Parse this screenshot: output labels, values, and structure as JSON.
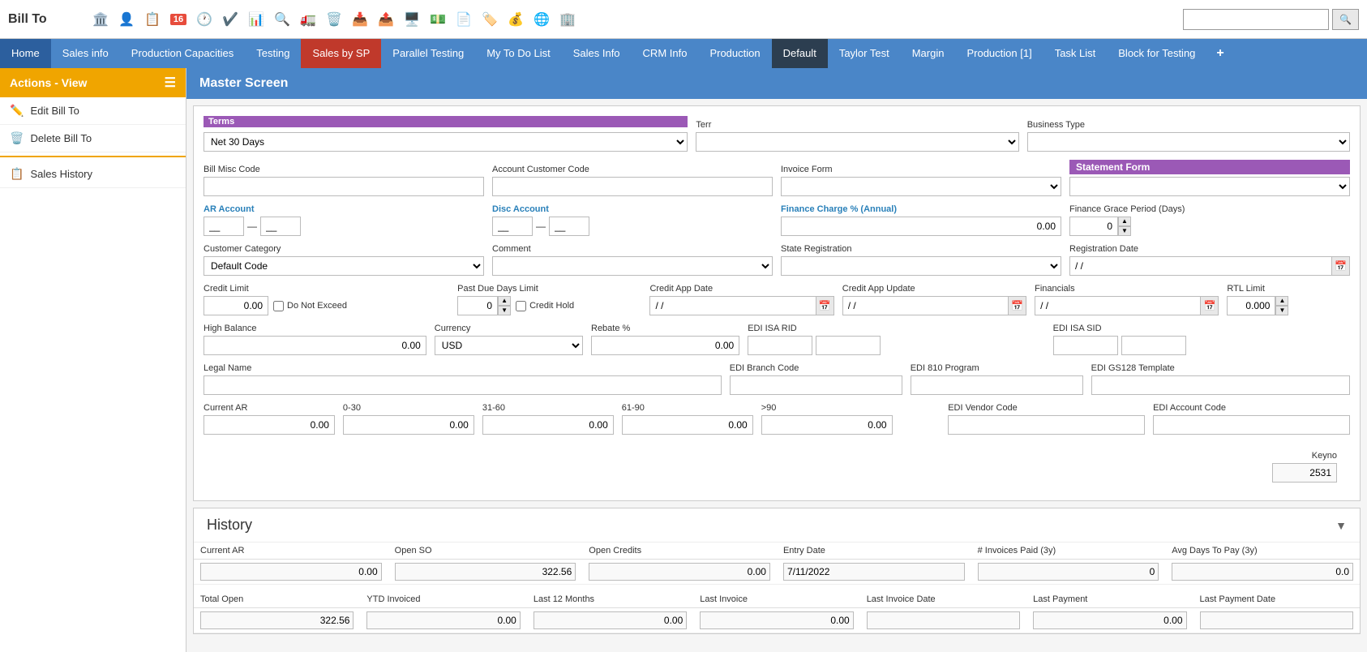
{
  "topbar": {
    "title": "Bill To",
    "search_placeholder": ""
  },
  "nav_tabs": [
    {
      "id": "home",
      "label": "Home",
      "class": "home"
    },
    {
      "id": "sales-info",
      "label": "Sales info"
    },
    {
      "id": "production-capacities",
      "label": "Production Capacities"
    },
    {
      "id": "testing",
      "label": "Testing"
    },
    {
      "id": "sales-by-sp",
      "label": "Sales by SP",
      "class": "active"
    },
    {
      "id": "parallel-testing",
      "label": "Parallel Testing"
    },
    {
      "id": "my-to-do-list",
      "label": "My To Do List"
    },
    {
      "id": "sales-info-2",
      "label": "Sales Info"
    },
    {
      "id": "crm-info",
      "label": "CRM Info"
    },
    {
      "id": "production",
      "label": "Production"
    },
    {
      "id": "default",
      "label": "Default"
    },
    {
      "id": "taylor-test",
      "label": "Taylor Test"
    },
    {
      "id": "margin",
      "label": "Margin"
    },
    {
      "id": "production-1",
      "label": "Production [1]"
    },
    {
      "id": "task-list",
      "label": "Task List"
    },
    {
      "id": "block-for-testing",
      "label": "Block for Testing"
    }
  ],
  "sidebar": {
    "header": "Actions - View",
    "items": [
      {
        "id": "edit-bill-to",
        "icon": "✏️",
        "label": "Edit Bill To"
      },
      {
        "id": "delete-bill-to",
        "icon": "🗑️",
        "label": "Delete Bill To"
      },
      {
        "id": "sales-history",
        "icon": "📋",
        "label": "Sales History"
      }
    ]
  },
  "content": {
    "header": "Master Screen",
    "terms_label": "Terms",
    "terms_value": "Net 30 Days",
    "terr_label": "Terr",
    "business_type_label": "Business Type",
    "bill_misc_code_label": "Bill Misc Code",
    "account_customer_code_label": "Account Customer Code",
    "invoice_form_label": "Invoice Form",
    "statement_form_label": "Statement Form",
    "ar_account_label": "AR Account",
    "disc_account_label": "Disc Account",
    "finance_charge_label": "Finance Charge % (Annual)",
    "finance_grace_label": "Finance Grace Period (Days)",
    "finance_grace_value": "0",
    "finance_charge_value": "0.00",
    "customer_category_label": "Customer Category",
    "customer_category_value": "Default Code",
    "comment_label": "Comment",
    "state_registration_label": "State Registration",
    "registration_date_label": "Registration Date",
    "registration_date_value": "/ /",
    "credit_limit_label": "Credit Limit",
    "credit_limit_value": "0.00",
    "do_not_exceed_label": "Do Not Exceed",
    "past_due_days_label": "Past Due Days Limit",
    "past_due_days_value": "0",
    "credit_hold_label": "Credit Hold",
    "credit_app_date_label": "Credit App Date",
    "credit_app_date_value": "/ /",
    "credit_app_update_label": "Credit App Update",
    "credit_app_update_value": "/ /",
    "financials_label": "Financials",
    "financials_value": "/ /",
    "rtl_limit_label": "RTL Limit",
    "rtl_limit_value": "0.000",
    "high_balance_label": "High Balance",
    "high_balance_value": "0.00",
    "currency_label": "Currency",
    "currency_value": "USD",
    "rebate_label": "Rebate %",
    "rebate_value": "0.00",
    "edi_isa_rid_label": "EDI ISA RID",
    "edi_isa_sid_label": "EDI ISA SID",
    "legal_name_label": "Legal Name",
    "edi_branch_code_label": "EDI Branch Code",
    "edi_810_program_label": "EDI 810 Program",
    "edi_gs128_label": "EDI GS128 Template",
    "current_ar_label": "Current AR",
    "ar_0_30_label": "0-30",
    "ar_31_60_label": "31-60",
    "ar_61_90_label": "61-90",
    "ar_90_plus_label": ">90",
    "edi_vendor_code_label": "EDI Vendor Code",
    "edi_account_code_label": "EDI Account Code",
    "current_ar_value": "0.00",
    "ar_0_30_value": "0.00",
    "ar_31_60_value": "0.00",
    "ar_61_90_value": "0.00",
    "ar_90_plus_value": "0.00",
    "keyno_label": "Keyno",
    "keyno_value": "2531"
  },
  "history": {
    "title": "History",
    "current_ar_label": "Current AR",
    "current_ar_value": "0.00",
    "open_so_label": "Open SO",
    "open_so_value": "322.56",
    "open_credits_label": "Open Credits",
    "open_credits_value": "0.00",
    "entry_date_label": "Entry Date",
    "entry_date_value": "7/11/2022",
    "invoices_paid_label": "# Invoices Paid (3y)",
    "invoices_paid_value": "0",
    "avg_days_label": "Avg Days To Pay (3y)",
    "avg_days_value": "0.0",
    "total_open_label": "Total Open",
    "total_open_value": "322.56",
    "ytd_invoiced_label": "YTD Invoiced",
    "ytd_invoiced_value": "0.00",
    "last_12_months_label": "Last 12 Months",
    "last_12_months_value": "0.00",
    "last_invoice_label": "Last Invoice",
    "last_invoice_value": "0.00",
    "last_invoice_date_label": "Last Invoice Date",
    "last_invoice_date_value": "",
    "last_payment_label": "Last Payment",
    "last_payment_value": "0.00",
    "last_payment_date_label": "Last Payment Date",
    "last_payment_date_value": ""
  },
  "icons": {
    "bank": "🏛️",
    "person": "👤",
    "calendar_16": "📅",
    "clock": "🕐",
    "check": "✔️",
    "grid": "📊",
    "magnify": "🔍",
    "truck": "🚛",
    "trash": "🗑️",
    "inbox": "📥",
    "export": "📤",
    "monitor": "🖥️",
    "dollar": "💵",
    "doc": "📄",
    "tag": "🏷️",
    "dollar2": "💰",
    "globe": "🌐",
    "building": "🏢"
  }
}
